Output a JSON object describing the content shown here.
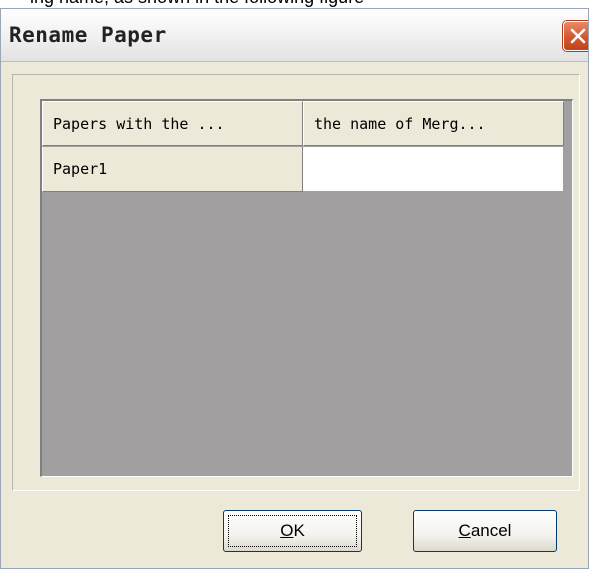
{
  "top_caption_fragment": "ing name, as shown in the following figure",
  "dialog": {
    "title": "Rename Paper",
    "close_icon": "close-x-icon"
  },
  "table": {
    "columns": [
      "Papers with the ...",
      "the name of Merg..."
    ],
    "rows": [
      {
        "paper": "Paper1",
        "merged_name": ""
      }
    ]
  },
  "buttons": {
    "ok": {
      "mnemonic": "O",
      "rest": "K"
    },
    "cancel": {
      "mnemonic": "C",
      "rest": "ancel"
    }
  },
  "colors": {
    "title_bg": "#f3f3f3",
    "close_button": "#d2572f",
    "dialog_bg": "#ece9d8",
    "grid_empty_bg": "#a19fa0",
    "cell_value_bg": "#ffffff"
  }
}
